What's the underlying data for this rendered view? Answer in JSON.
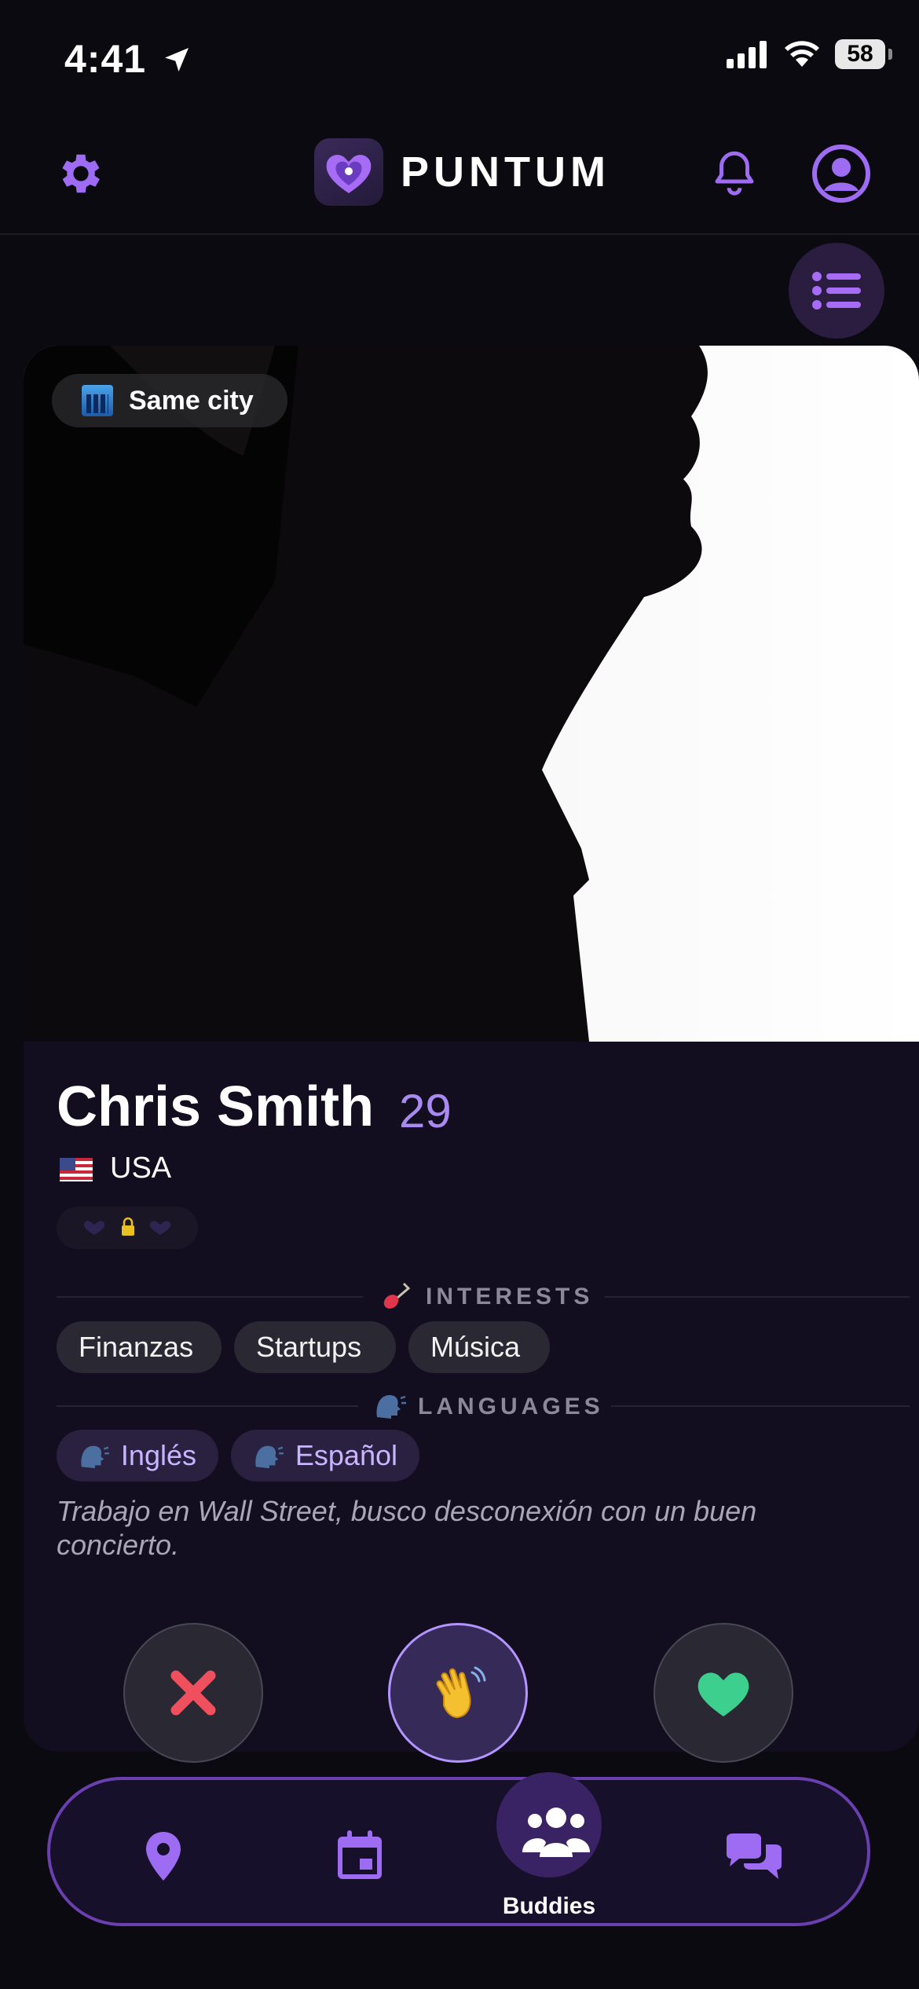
{
  "status_bar": {
    "time": "4:41",
    "battery": "58"
  },
  "header": {
    "brand": "PUNTUM"
  },
  "profile": {
    "badge": "Same city",
    "name": "Chris Smith",
    "age": "29",
    "country": "USA"
  },
  "interests": {
    "title": "INTERESTS",
    "items": [
      "Finanzas",
      "Startups",
      "Música"
    ]
  },
  "languages": {
    "title": "LANGUAGES",
    "items": [
      "Inglés",
      "Español"
    ]
  },
  "bio": "Trabajo en Wall Street, busco desconexión con un buen concierto.",
  "nav": {
    "active_label": "Buddies",
    "items": [
      "location-icon",
      "calendar-icon",
      "buddies-icon",
      "chat-icon"
    ]
  },
  "colors": {
    "accent": "#a66cf5",
    "pass": "#f0505e",
    "like": "#3ccf8e"
  }
}
